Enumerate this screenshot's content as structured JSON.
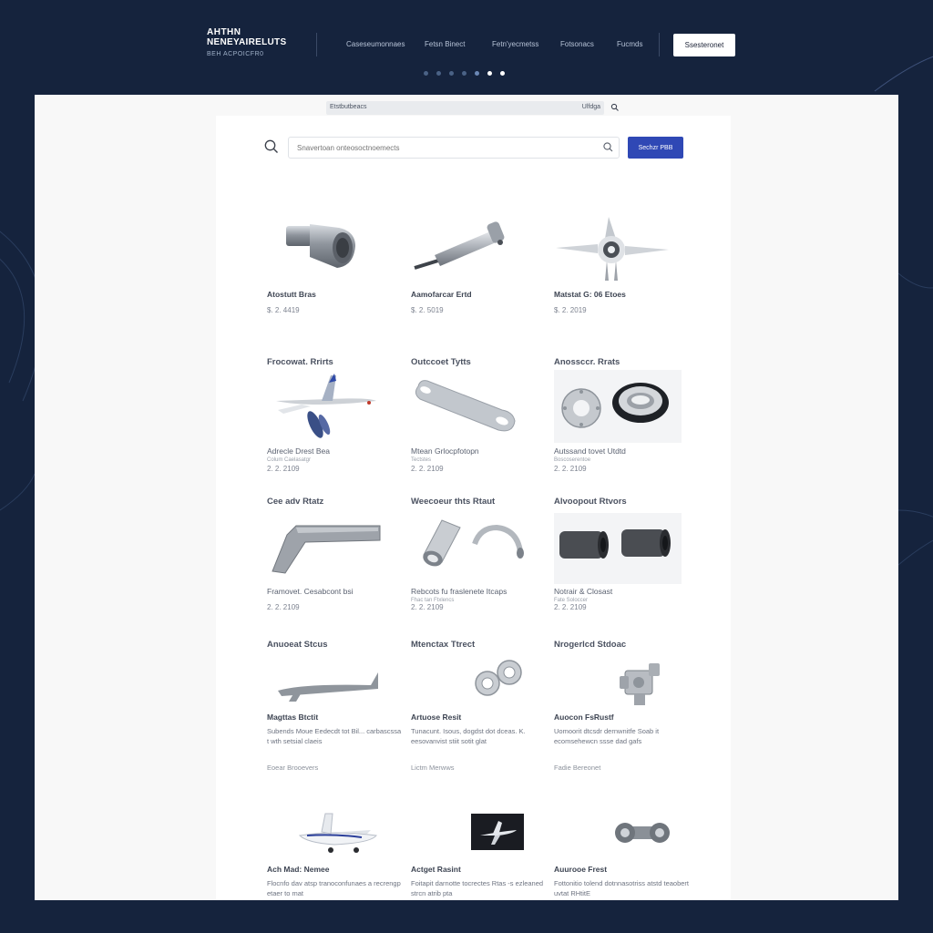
{
  "brand": {
    "line1": "AHTHN",
    "line2": "NENEYAIRELUTS",
    "sub": "BEH ACPOICFR0"
  },
  "nav": {
    "links": [
      "Caseseumonnaes",
      "Fetsn Binect",
      "Fetn'yecmetss",
      "Fotsonacs",
      "Fucmds"
    ],
    "cta": "Ssesteronet"
  },
  "breadcrumb": {
    "left": "Etstbutbeacs",
    "right": "Ulfdga"
  },
  "search": {
    "placeholder": "Snavertoan onteosoctnoemects",
    "button": "Sechzr PBB"
  },
  "products": [
    {
      "name": "Atostutt Bras",
      "price": "$. 2. 4419",
      "icon": "exhaust-nozzle-icon"
    },
    {
      "name": "Aamofarcar Ertd",
      "price": "$. 2. 5019",
      "icon": "strut-rod-icon"
    },
    {
      "name": "Matstat G: 06 Etoes",
      "price": "$. 2. 2019",
      "icon": "propeller-hub-icon"
    },
    {
      "heading": "Frocowat. Rrirts",
      "name": "Adrecle Drest Bea",
      "sub": "Colum Caelasatgr",
      "price": "2. 2. 2109",
      "icon": "jet-aircraft-icon"
    },
    {
      "heading": "Outccoet Tytts",
      "name": "Mtean Grlocpfotopn",
      "sub": "Tectstes",
      "price": "2. 2. 2109",
      "icon": "bracket-plate-icon"
    },
    {
      "heading": "Anossccr. Rrats",
      "name": "Autssand tovet Utdtd",
      "sub": "Boscoserentoe",
      "price": "2. 2. 2109",
      "icon": "washer-seal-icon"
    },
    {
      "heading": "Cee adv Rtatz",
      "name": "Framovet. Cesabcont bsi",
      "price": "2. 2. 2109",
      "icon": "landing-strut-icon"
    },
    {
      "heading": "Weecoeur thts Rtaut",
      "name": "Rebcots fu fraslenete Itcaps",
      "sub": "Fhac tan Ftxlencs",
      "price": "2. 2. 2109",
      "icon": "tube-fittings-icon"
    },
    {
      "heading": "Alvoopout Rtvors",
      "name": "Notrair & Closast",
      "sub": "Fate Soloccer",
      "price": "2. 2. 2109",
      "icon": "bushing-pair-icon"
    },
    {
      "heading": "Anuoeat Stcus",
      "name": "Magttas Btctit",
      "desc": "Subends Moue Eedecdt tot Bil... carbascssa t wth setsial claeis",
      "meta": "Eoear Brooevers",
      "icon": "aircraft-frame-icon"
    },
    {
      "heading": "Mtenctax Ttrect",
      "name": "Artuose Resit",
      "desc": "Tunacunt. Isous, dogdst dot dceas. K. eesovanvist stiit sotit glat",
      "meta": "Lictm Merwws",
      "icon": "bearing-rings-icon"
    },
    {
      "heading": "Nrogerlcd Stdoac",
      "name": "Auocon FsRustf",
      "desc": "Uomoorit dtcsdr dernwnitfe Soab it ecomsehewcn ssse dad gafs",
      "meta": "Fadie Bereonet",
      "icon": "valve-block-icon"
    },
    {
      "name": "Ach Mad: Nemee",
      "desc": "Flocnfo dav atsp tranoconfunaes a recrengp etaer to mat",
      "icon": "light-plane-icon"
    },
    {
      "name": "Actget Rasint",
      "desc": "Foitapit darnotte tocrectes Rtas -s ezleaned strcn atrib pta",
      "icon": "jet-silhouette-icon"
    },
    {
      "name": "Auurooe Frest",
      "desc": "Fottonitio tolend dotnnasotriss atstd teaobert uvtat RHtitE",
      "icon": "bearing-assembly-icon"
    }
  ]
}
